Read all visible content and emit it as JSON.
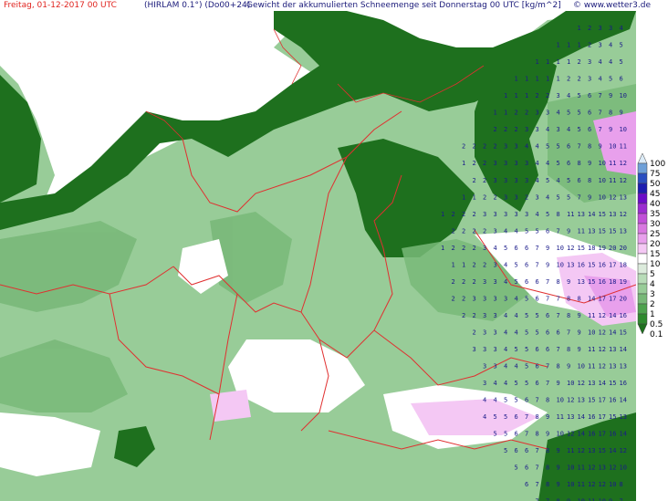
{
  "header": {
    "date": "Freitag, 01-12-2017   00 UTC",
    "model": "(HIRLAM 0.1°) (Do00+24)",
    "description": "Gewicht der akkumulierten Schneemenge seit Donnerstag 00 UTC [kg/m^2]",
    "site": "© www.wetter3.de"
  },
  "legend": {
    "levels": [
      "100",
      "75",
      "50",
      "45",
      "40",
      "35",
      "30",
      "25",
      "20",
      "15",
      "10",
      "5",
      "4",
      "3",
      "2",
      "1",
      "0.5",
      "0.1"
    ],
    "colors": [
      "#dcecf8",
      "#6ea0d8",
      "#2a4ec0",
      "#1c1cb0",
      "#6a0cc8",
      "#9a2cd0",
      "#c050d8",
      "#d878e0",
      "#e8a0ec",
      "#f4c8f4",
      "#ffffff",
      "#dcebdc",
      "#b8dcb8",
      "#98cc98",
      "#78b878",
      "#4ea24e",
      "#2e8a2e",
      "#1e701e"
    ]
  },
  "colors": {
    "land_snow_low": "#98cc98",
    "land_snow_0_1": "#1e701e",
    "sea": "#ffffff",
    "borders": "#e03030",
    "numbers": "#1a1a8a"
  },
  "grid_labels": {
    "rows": [
      "1 2 3 3 4",
      "1 1 1 2 3 4 5",
      "1 1 1 1 2 3 4 4 5",
      "1 1 1 1 1 2 2 3 4 5 6",
      "1 1 1 2 2 3 4 5 6 7 9 10",
      "1 1 2 2 3 3 4 5 5 6 7 8 9",
      "2 2 2 3 3 4 3 4 5 6 7 9 10",
      "2 2 2 2 3 3 4 4 5 5 6 7 8 9 10 11",
      "1 2 2 3 3 3 3 4 4 5 6 8 9 10 11 12",
      "2 2 3 3 3 3 4 5 4 5 6 8 10 11 12",
      "1 1 2 2 3 3 2 3 4 5 5 7 9 10 12 13",
      "1 2 2 2 3 3 3 3 3 4 5 8 11 13 14 15 13 12",
      "2 2 2 2 3 4 4 5 5 6 7 9 11 13 15 15 13",
      "1 2 2 2 3 4 5 6 6 7 9 10 12 15 18 19 20 20",
      "1 1 2 2 3 4 5 6 7 9 10 13 16 15 16 17 18",
      "2 2 2 3 3 4 5 6 6 7 8 9 13 15 16 18 19",
      "2 2 3 3 3 3 4 5 6 7 7 8 8 14 17 17 20",
      "2 2 3 3 4 4 5 5 6 7 8 9 11 12 14 16",
      "2 3 3 4 4 5 5 6 6 7 9 10 12 14 15",
      "3 3 3 4 5 5 6 6 7 8 9 11 12 13 14",
      "3 3 4 4 5 6 7 8 9 10 11 12 13 13",
      "3 4 4 5 5 6 7 9 10 12 13 14 15 16",
      "4 4 5 5 6 7 8 10 12 13 15 17 16 14",
      "4 5 5 6 7 8 9 11 13 14 16 17 15 13",
      "5 5 6 7 8 9 10 12 14 16 17 16 14",
      "5 6 6 7 8 9 11 12 13 15 14 12",
      "5 6 7 8 9 10 11 12 13 12 10",
      "6 7 8 9 10 11 12 12 10 8",
      "7 7 8 9 10 11 10 9 7"
    ]
  }
}
